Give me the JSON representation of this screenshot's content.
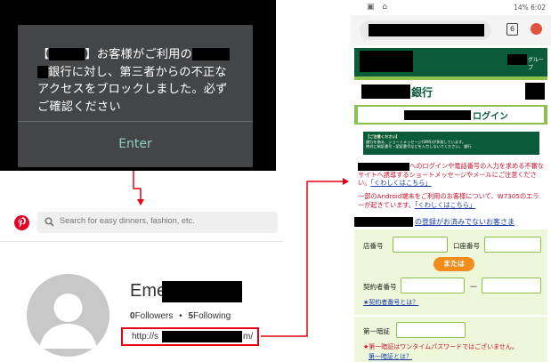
{
  "alert_dialog": {
    "line1": "】お客様がご利用の",
    "line2": "銀行に対し、第三者からの不正な",
    "line3": "アクセスをブロックしました。必ず",
    "line4": "ご確認ください",
    "bracket_open": "【",
    "button_label": "Enter",
    "button_color": "#8fd0c5"
  },
  "pinterest": {
    "search_placeholder": "Search for easy dinners, fashion, etc.",
    "name_prefix": "Eme",
    "followers_count": "0",
    "followers_label": "Followers",
    "separator": "•",
    "following_count": "5",
    "following_label": "Following",
    "website_prefix": "http://s",
    "website_suffix": "m/",
    "brand_color": "#e60023"
  },
  "phone": {
    "status_right": "14% 6:02",
    "tab_count": "6",
    "group_label": "グループ",
    "bank_suffix": "銀行",
    "login_label": "ログイン",
    "notice_title": "【ご注意ください】",
    "notice_line1": "銀行を偽る、ショートメッセージ(SMS)が多発しています。",
    "notice_line2": "絶対に暗証番号・認証番号などを入力しないでください。",
    "notice_tail": "銀行",
    "warning1": "へのログインや電話番号の入力を求める不審なサイトへ誘導するショートメッセージやメールにご注意ください。",
    "warning1_link": "「くわしくはこちら」",
    "warning2": "一部のAndroid端末をご利用のお客様について、W7305のエラーが起きています。",
    "warning2_link": "「くわしくはこちら」",
    "register_link": "の登録がお済みでないお客さま",
    "branch_label": "店番号",
    "account_label": "口座番号",
    "or_label": "または",
    "contract_label": "契約者番号",
    "dash": "－",
    "contract_help": "★契約者番号とは？",
    "pin2_label": "第一暗証",
    "pin2_note": "★第一暗証はワンタイムパスワードではございません。",
    "pin2_help": "第一暗証とは？",
    "theme_green": "#0b5a3a",
    "accent_green": "#8bc34a",
    "or_color": "#f28c1a"
  }
}
